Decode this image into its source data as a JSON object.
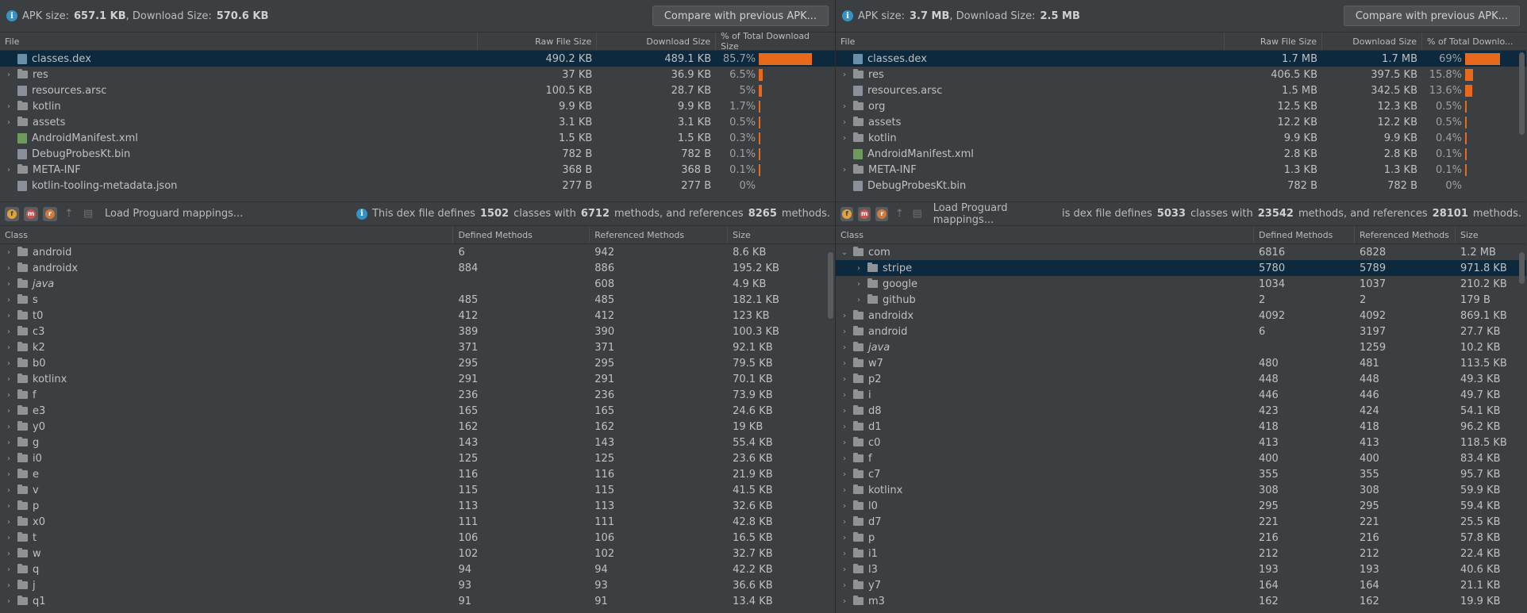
{
  "left": {
    "apk_label": "APK size:",
    "apk_size": "657.1 KB",
    "dl_label": ", Download Size:",
    "dl_size": "570.6 KB",
    "compare_button": "Compare with previous APK...",
    "file_headers": [
      "File",
      "Raw File Size",
      "Download Size",
      "% of Total Download Size"
    ],
    "files": [
      {
        "name": "classes.dex",
        "raw": "490.2 KB",
        "dl": "489.1 KB",
        "pct": "85.7%",
        "frac": 0.857,
        "expand": false,
        "icon": "dex-file-icon",
        "selected": true
      },
      {
        "name": "res",
        "raw": "37 KB",
        "dl": "36.9 KB",
        "pct": "6.5%",
        "frac": 0.065,
        "expand": true,
        "icon": "folder-icon",
        "selected": false
      },
      {
        "name": "resources.arsc",
        "raw": "100.5 KB",
        "dl": "28.7 KB",
        "pct": "5%",
        "frac": 0.05,
        "expand": false,
        "icon": "arsc-file-icon",
        "selected": false
      },
      {
        "name": "kotlin",
        "raw": "9.9 KB",
        "dl": "9.9 KB",
        "pct": "1.7%",
        "frac": 0.017,
        "expand": true,
        "icon": "folder-icon",
        "selected": false
      },
      {
        "name": "assets",
        "raw": "3.1 KB",
        "dl": "3.1 KB",
        "pct": "0.5%",
        "frac": 0.005,
        "expand": true,
        "icon": "folder-icon",
        "selected": false
      },
      {
        "name": "AndroidManifest.xml",
        "raw": "1.5 KB",
        "dl": "1.5 KB",
        "pct": "0.3%",
        "frac": 0.003,
        "expand": false,
        "icon": "xml-file-icon",
        "selected": false
      },
      {
        "name": "DebugProbesKt.bin",
        "raw": "782 B",
        "dl": "782 B",
        "pct": "0.1%",
        "frac": 0.001,
        "expand": false,
        "icon": "bin-file-icon",
        "selected": false
      },
      {
        "name": "META-INF",
        "raw": "368 B",
        "dl": "368 B",
        "pct": "0.1%",
        "frac": 0.001,
        "expand": true,
        "icon": "folder-icon",
        "selected": false
      },
      {
        "name": "kotlin-tooling-metadata.json",
        "raw": "277 B",
        "dl": "277 B",
        "pct": "0%",
        "frac": 0,
        "expand": false,
        "icon": "json-file-icon",
        "selected": false
      }
    ],
    "proguard_label": "Load Proguard mappings...",
    "dex_msg_pre": "This dex file defines",
    "dex_classes": "1502",
    "dex_msg_mid1": "classes with",
    "dex_methods": "6712",
    "dex_msg_mid2": "methods, and references",
    "dex_refs": "8265",
    "dex_msg_post": "methods.",
    "class_headers": [
      "Class",
      "Defined Methods",
      "Referenced Methods",
      "Size"
    ],
    "classes": [
      {
        "name": "android",
        "def": "6",
        "ref": "942",
        "size": "8.6 KB",
        "italic": false
      },
      {
        "name": "androidx",
        "def": "884",
        "ref": "886",
        "size": "195.2 KB",
        "italic": false
      },
      {
        "name": "java",
        "def": "",
        "ref": "608",
        "size": "4.9 KB",
        "italic": true
      },
      {
        "name": "s",
        "def": "485",
        "ref": "485",
        "size": "182.1 KB",
        "italic": false
      },
      {
        "name": "t0",
        "def": "412",
        "ref": "412",
        "size": "123 KB",
        "italic": false
      },
      {
        "name": "c3",
        "def": "389",
        "ref": "390",
        "size": "100.3 KB",
        "italic": false
      },
      {
        "name": "k2",
        "def": "371",
        "ref": "371",
        "size": "92.1 KB",
        "italic": false
      },
      {
        "name": "b0",
        "def": "295",
        "ref": "295",
        "size": "79.5 KB",
        "italic": false
      },
      {
        "name": "kotlinx",
        "def": "291",
        "ref": "291",
        "size": "70.1 KB",
        "italic": false
      },
      {
        "name": "f",
        "def": "236",
        "ref": "236",
        "size": "73.9 KB",
        "italic": false
      },
      {
        "name": "e3",
        "def": "165",
        "ref": "165",
        "size": "24.6 KB",
        "italic": false
      },
      {
        "name": "y0",
        "def": "162",
        "ref": "162",
        "size": "19 KB",
        "italic": false
      },
      {
        "name": "g",
        "def": "143",
        "ref": "143",
        "size": "55.4 KB",
        "italic": false
      },
      {
        "name": "i0",
        "def": "125",
        "ref": "125",
        "size": "23.6 KB",
        "italic": false
      },
      {
        "name": "e",
        "def": "116",
        "ref": "116",
        "size": "21.9 KB",
        "italic": false
      },
      {
        "name": "v",
        "def": "115",
        "ref": "115",
        "size": "41.5 KB",
        "italic": false
      },
      {
        "name": "p",
        "def": "113",
        "ref": "113",
        "size": "32.6 KB",
        "italic": false
      },
      {
        "name": "x0",
        "def": "111",
        "ref": "111",
        "size": "42.8 KB",
        "italic": false
      },
      {
        "name": "t",
        "def": "106",
        "ref": "106",
        "size": "16.5 KB",
        "italic": false
      },
      {
        "name": "w",
        "def": "102",
        "ref": "102",
        "size": "32.7 KB",
        "italic": false
      },
      {
        "name": "q",
        "def": "94",
        "ref": "94",
        "size": "42.2 KB",
        "italic": false
      },
      {
        "name": "j",
        "def": "93",
        "ref": "93",
        "size": "36.6 KB",
        "italic": false
      },
      {
        "name": "q1",
        "def": "91",
        "ref": "91",
        "size": "13.4 KB",
        "italic": false
      }
    ]
  },
  "right": {
    "apk_label": "APK size:",
    "apk_size": "3.7 MB",
    "dl_label": ", Download Size:",
    "dl_size": "2.5 MB",
    "compare_button": "Compare with previous APK...",
    "file_headers": [
      "File",
      "Raw File Size",
      "Download Size",
      "% of Total Downlo..."
    ],
    "files": [
      {
        "name": "classes.dex",
        "raw": "1.7 MB",
        "dl": "1.7 MB",
        "pct": "69%",
        "frac": 0.69,
        "expand": false,
        "icon": "dex-file-icon",
        "selected": true
      },
      {
        "name": "res",
        "raw": "406.5 KB",
        "dl": "397.5 KB",
        "pct": "15.8%",
        "frac": 0.158,
        "expand": true,
        "icon": "folder-icon",
        "selected": false
      },
      {
        "name": "resources.arsc",
        "raw": "1.5 MB",
        "dl": "342.5 KB",
        "pct": "13.6%",
        "frac": 0.136,
        "expand": false,
        "icon": "arsc-file-icon",
        "selected": false
      },
      {
        "name": "org",
        "raw": "12.5 KB",
        "dl": "12.3 KB",
        "pct": "0.5%",
        "frac": 0.005,
        "expand": true,
        "icon": "folder-icon",
        "selected": false
      },
      {
        "name": "assets",
        "raw": "12.2 KB",
        "dl": "12.2 KB",
        "pct": "0.5%",
        "frac": 0.005,
        "expand": true,
        "icon": "folder-icon",
        "selected": false
      },
      {
        "name": "kotlin",
        "raw": "9.9 KB",
        "dl": "9.9 KB",
        "pct": "0.4%",
        "frac": 0.004,
        "expand": true,
        "icon": "folder-icon",
        "selected": false
      },
      {
        "name": "AndroidManifest.xml",
        "raw": "2.8 KB",
        "dl": "2.8 KB",
        "pct": "0.1%",
        "frac": 0.001,
        "expand": false,
        "icon": "xml-file-icon",
        "selected": false
      },
      {
        "name": "META-INF",
        "raw": "1.3 KB",
        "dl": "1.3 KB",
        "pct": "0.1%",
        "frac": 0.001,
        "expand": true,
        "icon": "folder-icon",
        "selected": false
      },
      {
        "name": "DebugProbesKt.bin",
        "raw": "782 B",
        "dl": "782 B",
        "pct": "0%",
        "frac": 0,
        "expand": false,
        "icon": "bin-file-icon",
        "selected": false
      }
    ],
    "proguard_label": "Load Proguard mappings...",
    "dex_msg_pre": "is dex file defines",
    "dex_classes": "5033",
    "dex_msg_mid1": "classes with",
    "dex_methods": "23542",
    "dex_msg_mid2": "methods, and references",
    "dex_refs": "28101",
    "dex_msg_post": "methods.",
    "class_headers": [
      "Class",
      "Defined Methods",
      "Referenced Methods",
      "Size"
    ],
    "classes": [
      {
        "name": "com",
        "def": "6816",
        "ref": "6828",
        "size": "1.2 MB",
        "italic": false,
        "open": true,
        "level": 0,
        "selected": false
      },
      {
        "name": "stripe",
        "def": "5780",
        "ref": "5789",
        "size": "971.8 KB",
        "italic": false,
        "open": false,
        "level": 1,
        "selected": true
      },
      {
        "name": "google",
        "def": "1034",
        "ref": "1037",
        "size": "210.2 KB",
        "italic": false,
        "open": false,
        "level": 1,
        "selected": false
      },
      {
        "name": "github",
        "def": "2",
        "ref": "2",
        "size": "179 B",
        "italic": false,
        "open": false,
        "level": 1,
        "selected": false
      },
      {
        "name": "androidx",
        "def": "4092",
        "ref": "4092",
        "size": "869.1 KB",
        "italic": false,
        "open": false,
        "level": 0,
        "selected": false
      },
      {
        "name": "android",
        "def": "6",
        "ref": "3197",
        "size": "27.7 KB",
        "italic": false,
        "open": false,
        "level": 0,
        "selected": false
      },
      {
        "name": "java",
        "def": "",
        "ref": "1259",
        "size": "10.2 KB",
        "italic": true,
        "open": false,
        "level": 0,
        "selected": false
      },
      {
        "name": "w7",
        "def": "480",
        "ref": "481",
        "size": "113.5 KB",
        "italic": false,
        "open": false,
        "level": 0,
        "selected": false
      },
      {
        "name": "p2",
        "def": "448",
        "ref": "448",
        "size": "49.3 KB",
        "italic": false,
        "open": false,
        "level": 0,
        "selected": false
      },
      {
        "name": "i",
        "def": "446",
        "ref": "446",
        "size": "49.7 KB",
        "italic": false,
        "open": false,
        "level": 0,
        "selected": false
      },
      {
        "name": "d8",
        "def": "423",
        "ref": "424",
        "size": "54.1 KB",
        "italic": false,
        "open": false,
        "level": 0,
        "selected": false
      },
      {
        "name": "d1",
        "def": "418",
        "ref": "418",
        "size": "96.2 KB",
        "italic": false,
        "open": false,
        "level": 0,
        "selected": false
      },
      {
        "name": "c0",
        "def": "413",
        "ref": "413",
        "size": "118.5 KB",
        "italic": false,
        "open": false,
        "level": 0,
        "selected": false
      },
      {
        "name": "f",
        "def": "400",
        "ref": "400",
        "size": "83.4 KB",
        "italic": false,
        "open": false,
        "level": 0,
        "selected": false
      },
      {
        "name": "c7",
        "def": "355",
        "ref": "355",
        "size": "95.7 KB",
        "italic": false,
        "open": false,
        "level": 0,
        "selected": false
      },
      {
        "name": "kotlinx",
        "def": "308",
        "ref": "308",
        "size": "59.9 KB",
        "italic": false,
        "open": false,
        "level": 0,
        "selected": false
      },
      {
        "name": "l0",
        "def": "295",
        "ref": "295",
        "size": "59.4 KB",
        "italic": false,
        "open": false,
        "level": 0,
        "selected": false
      },
      {
        "name": "d7",
        "def": "221",
        "ref": "221",
        "size": "25.5 KB",
        "italic": false,
        "open": false,
        "level": 0,
        "selected": false
      },
      {
        "name": "p",
        "def": "216",
        "ref": "216",
        "size": "57.8 KB",
        "italic": false,
        "open": false,
        "level": 0,
        "selected": false
      },
      {
        "name": "i1",
        "def": "212",
        "ref": "212",
        "size": "22.4 KB",
        "italic": false,
        "open": false,
        "level": 0,
        "selected": false
      },
      {
        "name": "l3",
        "def": "193",
        "ref": "193",
        "size": "40.6 KB",
        "italic": false,
        "open": false,
        "level": 0,
        "selected": false
      },
      {
        "name": "y7",
        "def": "164",
        "ref": "164",
        "size": "21.1 KB",
        "italic": false,
        "open": false,
        "level": 0,
        "selected": false
      },
      {
        "name": "m3",
        "def": "162",
        "ref": "162",
        "size": "19.9 KB",
        "italic": false,
        "open": false,
        "level": 0,
        "selected": false
      }
    ]
  },
  "colors": {
    "accent_bar": "#e8691b",
    "selection": "#0d293e",
    "info_icon": "#3592c4"
  }
}
